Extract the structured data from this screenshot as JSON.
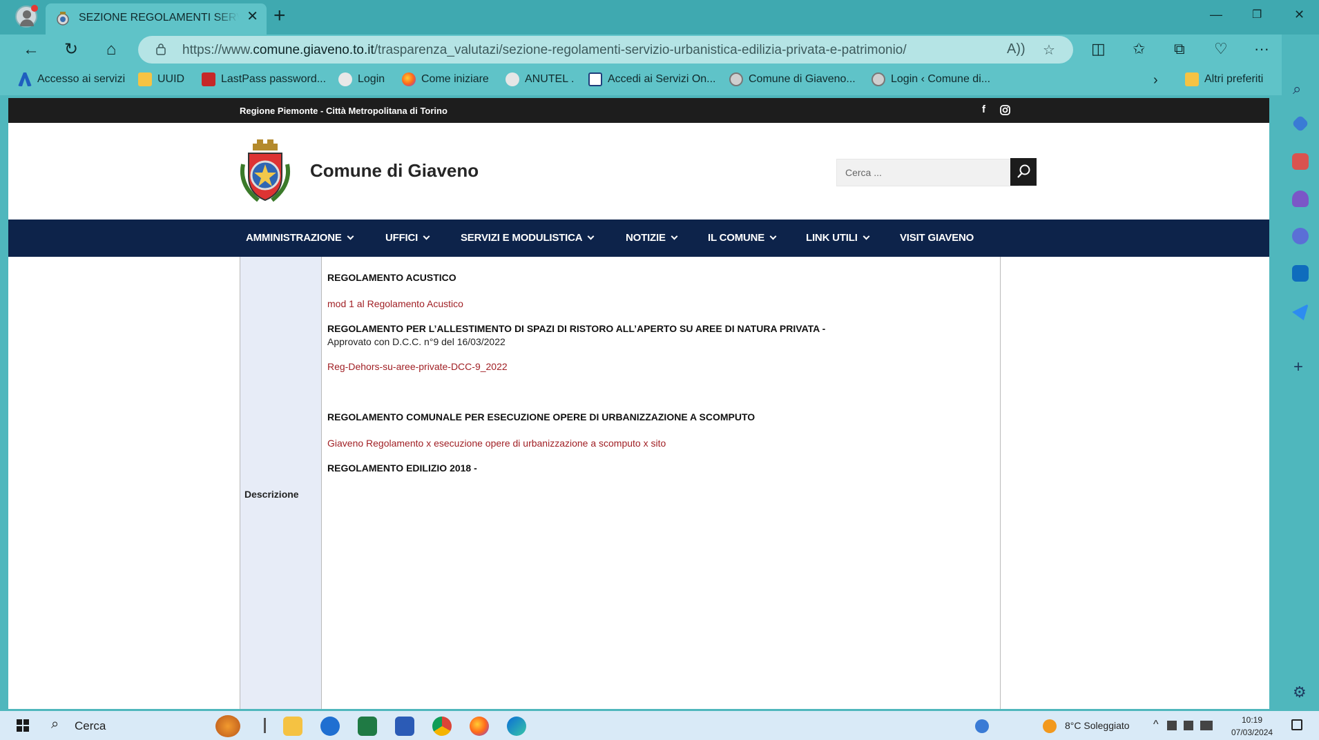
{
  "browser": {
    "tab_title": "SEZIONE REGOLAMENTI SERVIZIO URBANISTICA",
    "url_prefix": "https://www.",
    "url_host": "comune.giaveno.to.it",
    "url_path": "/trasparenza_valutazi/sezione-regolamenti-servizio-urbanistica-edilizia-privata-e-patrimonio/",
    "bookmarks": [
      {
        "label": "Accesso ai servizi",
        "icon": "signal-icon"
      },
      {
        "label": "UUID",
        "icon": "folder-icon"
      },
      {
        "label": "LastPass password...",
        "icon": "lastpass-icon"
      },
      {
        "label": "Login",
        "icon": "login-icon"
      },
      {
        "label": "Come iniziare",
        "icon": "firefox-icon"
      },
      {
        "label": "ANUTEL .",
        "icon": "anutel-icon"
      },
      {
        "label": "Accedi ai Servizi On...",
        "icon": "user-icon"
      },
      {
        "label": "Comune di Giaveno...",
        "icon": "crest-icon"
      },
      {
        "label": "Login ‹ Comune di...",
        "icon": "crest-icon"
      }
    ],
    "other_favorites": "Altri preferiti"
  },
  "site": {
    "region": "Regione Piemonte - Città Metropolitana di Torino",
    "title": "Comune di Giaveno",
    "search_placeholder": "Cerca ...",
    "nav": [
      {
        "label": "AMMINISTRAZIONE",
        "has_dropdown": true
      },
      {
        "label": "UFFICI",
        "has_dropdown": true
      },
      {
        "label": "SERVIZI E MODULISTICA",
        "has_dropdown": true
      },
      {
        "label": "NOTIZIE",
        "has_dropdown": true
      },
      {
        "label": "IL COMUNE",
        "has_dropdown": true
      },
      {
        "label": "LINK UTILI",
        "has_dropdown": true
      },
      {
        "label": "VISIT GIAVENO",
        "has_dropdown": false
      }
    ],
    "colors": {
      "nav_bg": "#0d234a",
      "link": "#a01f24",
      "top_strip": "#1d1d1d"
    }
  },
  "content": {
    "label": "Descrizione",
    "items": [
      {
        "type": "heading",
        "text": "REGOLAMENTO ACUSTICO"
      },
      {
        "type": "link",
        "text": "mod 1 al Regolamento Acustico"
      },
      {
        "type": "heading",
        "text": "REGOLAMENTO PER L’ALLESTIMENTO DI SPAZI DI RISTORO ALL’APERTO SU AREE DI NATURA PRIVATA  -"
      },
      {
        "type": "plain",
        "text": "Approvato con D.C.C. n°9 del 16/03/2022"
      },
      {
        "type": "link",
        "text": "Reg-Dehors-su-aree-private-DCC-9_2022"
      },
      {
        "type": "heading",
        "text": "REGOLAMENTO COMUNALE PER ESECUZIONE OPERE DI URBANIZZAZIONE A SCOMPUTO"
      },
      {
        "type": "link",
        "text": "Giaveno Regolamento x esecuzione opere di urbanizzazione a scomputo x sito"
      },
      {
        "type": "heading",
        "text": "REGOLAMENTO EDILIZIO 2018 -"
      }
    ]
  },
  "taskbar": {
    "search": "Cerca",
    "weather": "8°C  Soleggiato",
    "time": "10:19",
    "date": "07/03/2024"
  }
}
